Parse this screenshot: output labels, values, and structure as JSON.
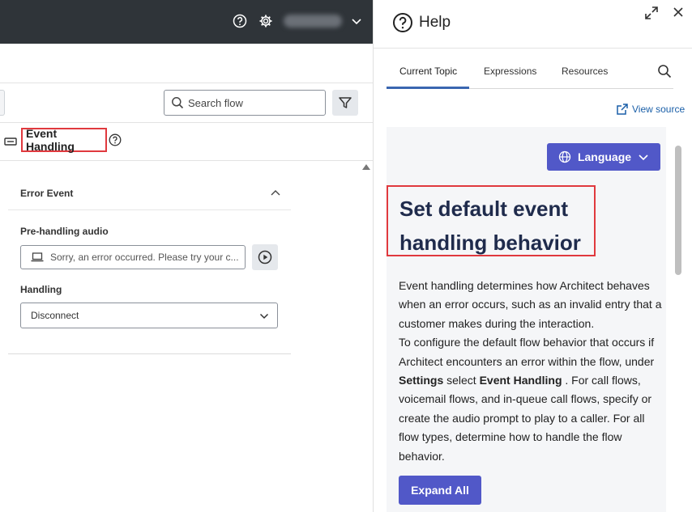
{
  "left": {
    "search": {
      "placeholder": "Search flow"
    },
    "section": {
      "title": "Event Handling"
    },
    "card": {
      "title": "Error Event",
      "pre_handling_label": "Pre-handling audio",
      "pre_handling_value": "Sorry, an error occurred. Please try your c...",
      "handling_label": "Handling",
      "handling_value": "Disconnect"
    }
  },
  "help": {
    "title": "Help",
    "tabs": [
      {
        "label": "Current Topic",
        "active": true
      },
      {
        "label": "Expressions",
        "active": false
      },
      {
        "label": "Resources",
        "active": false
      }
    ],
    "view_source": "View source",
    "language_button": "Language",
    "heading": "Set default event handling behavior",
    "p1": "Event handling determines how Architect behaves when an error occurs, such as an invalid entry that a customer makes during the interaction.",
    "p2_part1": "To configure the default flow behavior that occurs if Architect encounters an error within the flow, under ",
    "p2_bold1": "Settings",
    "p2_part2": " select ",
    "p2_bold2": "Event Handling",
    "p2_part3": " . For call flows, voicemail flows, and in-queue call flows, specify or create the audio prompt to play to a caller. For all flow types, determine how to handle the flow behavior.",
    "expand_all": "Expand All"
  },
  "colors": {
    "topbar": "#2f3439",
    "accent_button": "#5158c8",
    "highlight_border": "#e0393e",
    "heading": "#1f2b4c",
    "link": "#1a5fa8"
  }
}
